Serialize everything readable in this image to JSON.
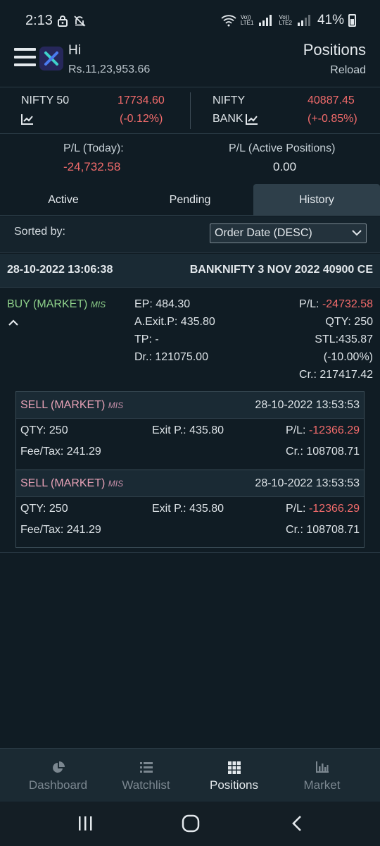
{
  "status": {
    "time": "2:13",
    "sim1": "LTE1",
    "sim2": "LTE2",
    "volte": "Vo))",
    "battery": "41%"
  },
  "header": {
    "greeting": "Hi",
    "balance": "Rs.11,23,953.66",
    "title": "Positions",
    "reload": "Reload"
  },
  "indices": {
    "nifty": {
      "name": "NIFTY 50",
      "value": "17734.60",
      "change": "(-0.12%)"
    },
    "bank": {
      "name1": "NIFTY",
      "name2": "BANK",
      "value": "40887.45",
      "change": "(+-0.85%)"
    }
  },
  "pl": {
    "today_label": "P/L (Today):",
    "today_value": "-24,732.58",
    "active_label": "P/L (Active Positions)",
    "active_value": "0.00"
  },
  "tabs": [
    "Active",
    "Pending",
    "History"
  ],
  "sort": {
    "label": "Sorted by:",
    "value": "Order Date (DESC)"
  },
  "trade": {
    "date": "28-10-2022 13:06:38",
    "symbol": "BANKNIFTY 3 NOV 2022 40900 CE",
    "side": "BUY (MARKET)",
    "product": "MIS",
    "ep": "EP: 484.30",
    "aexit": "A.Exit.P: 435.80",
    "tp": "TP: -",
    "dr": "Dr.: 121075.00",
    "pl_label": "P/L: ",
    "pl_value": "-24732.58",
    "qty": "QTY: 250",
    "stl": "STL:435.87",
    "stl_pct": "(-10.00%)",
    "cr": "Cr.: 217417.42"
  },
  "fills": [
    {
      "side": "SELL (MARKET)",
      "product": "MIS",
      "time": "28-10-2022 13:53:53",
      "qty": "QTY: 250",
      "exit": "Exit P.: 435.80",
      "pl_label": "P/L: ",
      "pl_value": "-12366.29",
      "fee": "Fee/Tax: 241.29",
      "cr": "Cr.: 108708.71"
    },
    {
      "side": "SELL (MARKET)",
      "product": "MIS",
      "time": "28-10-2022 13:53:53",
      "qty": "QTY: 250",
      "exit": "Exit P.: 435.80",
      "pl_label": "P/L: ",
      "pl_value": "-12366.29",
      "fee": "Fee/Tax: 241.29",
      "cr": "Cr.: 108708.71"
    }
  ],
  "nav": [
    "Dashboard",
    "Watchlist",
    "Positions",
    "Market"
  ],
  "colors": {
    "background": "#101c24",
    "loss": "#f26b6b",
    "buy": "#8ed08a",
    "sell": "#e6a1b6"
  }
}
